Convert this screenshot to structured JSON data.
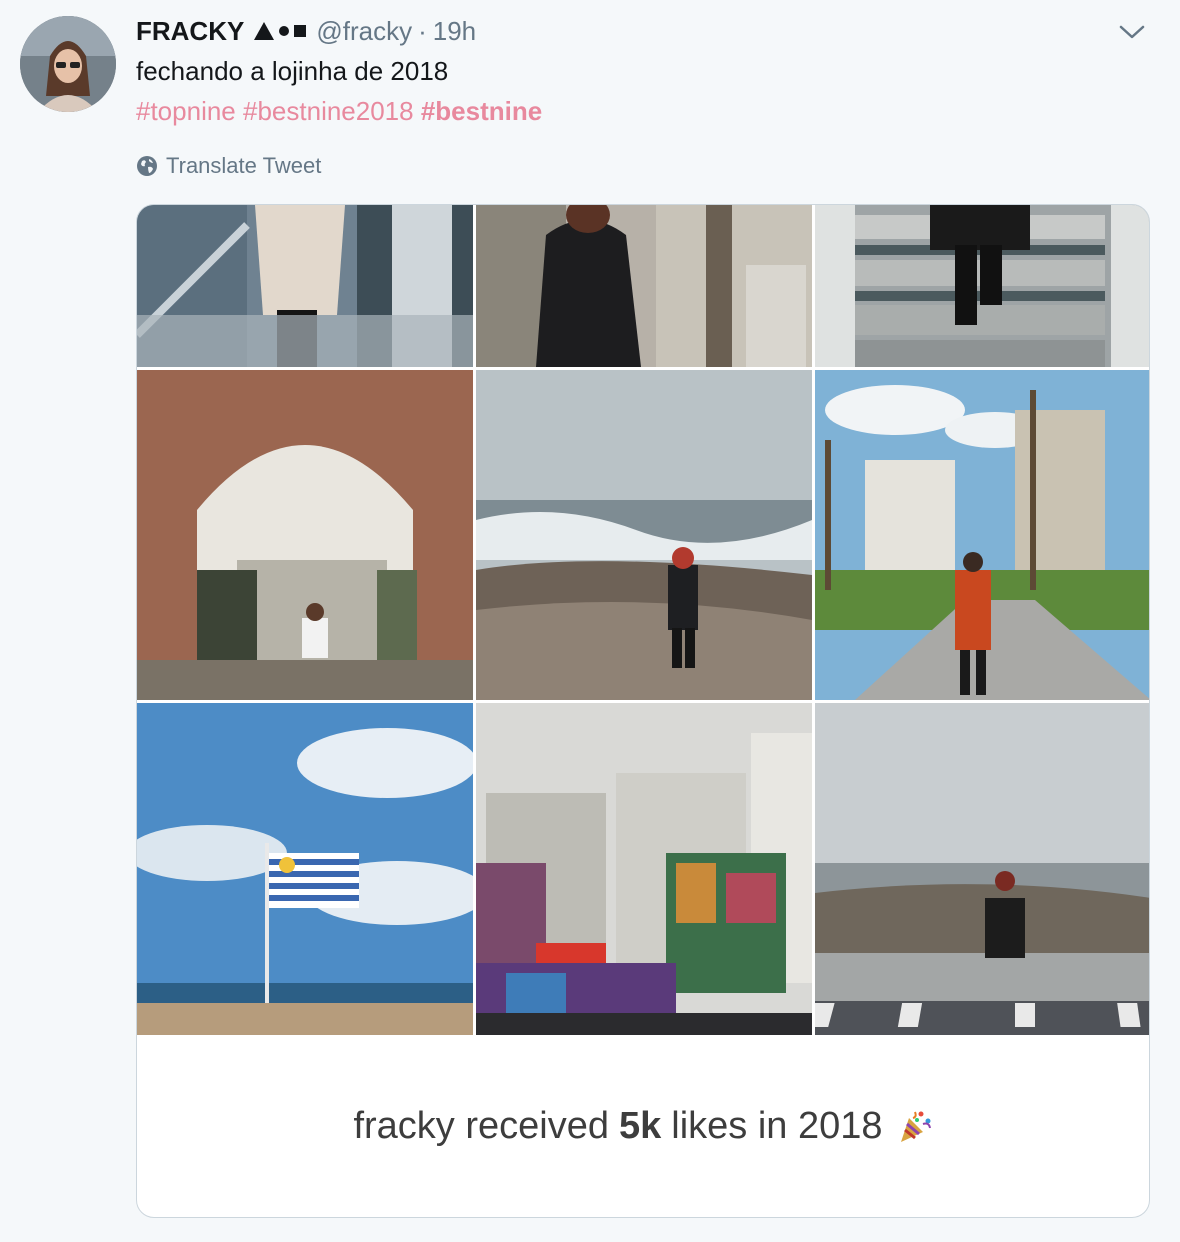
{
  "tweet": {
    "author_name": "FRACKY",
    "handle": "@fracky",
    "separator": "·",
    "time": "19h",
    "text": "fechando a lojinha de 2018",
    "hashtags": [
      "#topnine",
      "#bestnine2018",
      "#bestnine"
    ],
    "translate_label": "Translate Tweet"
  },
  "media": {
    "caption_prefix": "fracky received",
    "caption_bold": "5k",
    "caption_suffix": "likes in 2018"
  },
  "colors": {
    "hashtag": "#e8899e",
    "muted": "#657786",
    "card_border": "#ccd6dd"
  },
  "icons": [
    "chevron-down-icon",
    "globe-icon",
    "party-popper-icon"
  ]
}
